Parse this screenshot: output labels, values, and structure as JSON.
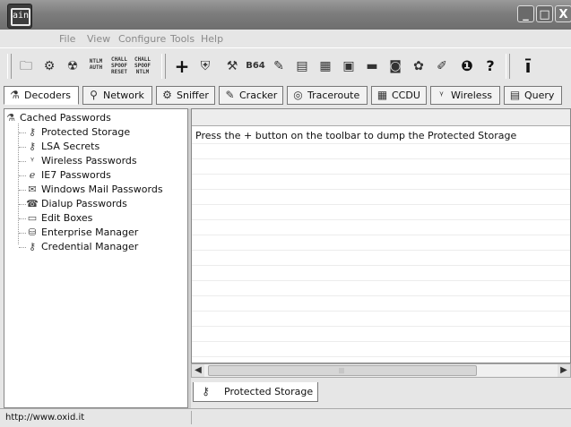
{
  "window": {
    "logo_text": "ain",
    "controls": {
      "minimize": "_",
      "maximize": "□",
      "close": "X"
    }
  },
  "menu": [
    "File",
    "View",
    "Configure",
    "Tools",
    "Help"
  ],
  "toolbar": {
    "icons": [
      "folder-icon",
      "network-icon",
      "radiation-icon",
      "ntlm-auth-icon",
      "chall-spoof-reset-icon",
      "chall-spoof-ntlm-icon",
      "add-icon",
      "shield-icon",
      "decoder-icon",
      "base64-icon",
      "hash-icon",
      "lm-icon",
      "md5-icon",
      "rsa-icon",
      "card-icon",
      "disk-icon",
      "gear-icon",
      "edit-icon",
      "info-icon",
      "help-icon",
      "logo-icon"
    ],
    "labels": {
      "ntlm_auth": [
        "NTLM",
        "AUTH"
      ],
      "spoof_reset": [
        "CHALL",
        "SPOOF",
        "RESET"
      ],
      "spoof_ntlm": [
        "CHALL",
        "SPOOF",
        "NTLM"
      ],
      "base64": "B64"
    }
  },
  "tabs": [
    {
      "label": "Decoders",
      "icon": "decoders-icon",
      "active": true
    },
    {
      "label": "Network",
      "icon": "network-icon",
      "active": false
    },
    {
      "label": "Sniffer",
      "icon": "sniffer-icon",
      "active": false
    },
    {
      "label": "Cracker",
      "icon": "cracker-icon",
      "active": false
    },
    {
      "label": "Traceroute",
      "icon": "traceroute-icon",
      "active": false
    },
    {
      "label": "CCDU",
      "icon": "ccdu-icon",
      "active": false
    },
    {
      "label": "Wireless",
      "icon": "wireless-icon",
      "active": false
    },
    {
      "label": "Query",
      "icon": "query-icon",
      "active": false
    }
  ],
  "tree": {
    "root": "Cached Passwords",
    "items": [
      "Protected Storage",
      "LSA Secrets",
      "Wireless Passwords",
      "IE7 Passwords",
      "Windows Mail Passwords",
      "Dialup Passwords",
      "Edit Boxes",
      "Enterprise Manager",
      "Credential Manager"
    ]
  },
  "main": {
    "message": "Press the + button on the toolbar to dump the Protected Storage"
  },
  "bottom_tab": {
    "label": "Protected Storage"
  },
  "status": {
    "text": "http://www.oxid.it"
  }
}
